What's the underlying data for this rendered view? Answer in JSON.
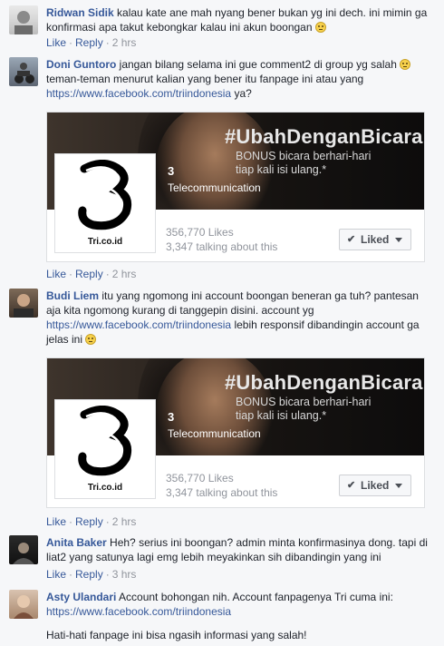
{
  "actions": {
    "like": "Like",
    "reply": "Reply",
    "dot": "·"
  },
  "colors": {
    "link": "#365899",
    "meta": "#90949c",
    "background": "#f6f7f9"
  },
  "comments": [
    {
      "author": "Ridwan Sidik",
      "text": "kalau kate ane mah nyang bener bukan yg ini dech. ini mimin ga konfirmasi apa takut kebongkar kalau ini akun boongan",
      "emoji": "confused-emoji",
      "time": "2 hrs"
    },
    {
      "author": "Doni Guntoro",
      "text": "jangan bilang selama ini gue comment2 di group yg salah",
      "emoji": "confused-emoji",
      "text2": "teman-teman menurut kalian yang bener itu fanpage ini atau yang",
      "link": "https://www.facebook.com/triindonesia",
      "after_link": "ya?",
      "time": "2 hrs"
    },
    {
      "author": "Budi Liem",
      "text": "itu yang ngomong ini account boongan beneran ga tuh? pantesan aja kita ngomong kurang di tanggepin disini. account yg",
      "link": "https://www.facebook.com/triindonesia",
      "after_link": "lebih responsif dibandingin account ga jelas ini",
      "emoji": "unamused-emoji",
      "time": "2 hrs"
    },
    {
      "author": "Anita Baker",
      "text": "Heh? serius ini boongan? admin minta konfirmasinya dong. tapi di liat2 yang satunya lagi emg lebih meyakinkan sih dibandingin yang ini",
      "time": "3 hrs"
    },
    {
      "author": "Asty Ulandari",
      "text": "Account bohongan nih. Account fanpagenya Tri cuma ini:",
      "link": "https://www.facebook.com/triindonesia",
      "last_line": "Hati-hati fanpage ini bisa ngasih informasi yang salah!"
    }
  ],
  "page_card": {
    "headline": "#UbahDenganBicara",
    "tagline_1": "BONUS bicara berhari-hari",
    "tagline_2": "tiap kali isi ulang.*",
    "page_name": "3",
    "category": "Telecommunication",
    "logo_text": "Tri.co.id",
    "likes": "356,770 Likes",
    "talking": "3,347 talking about this",
    "liked_label": "Liked",
    "check_glyph": "✔"
  }
}
